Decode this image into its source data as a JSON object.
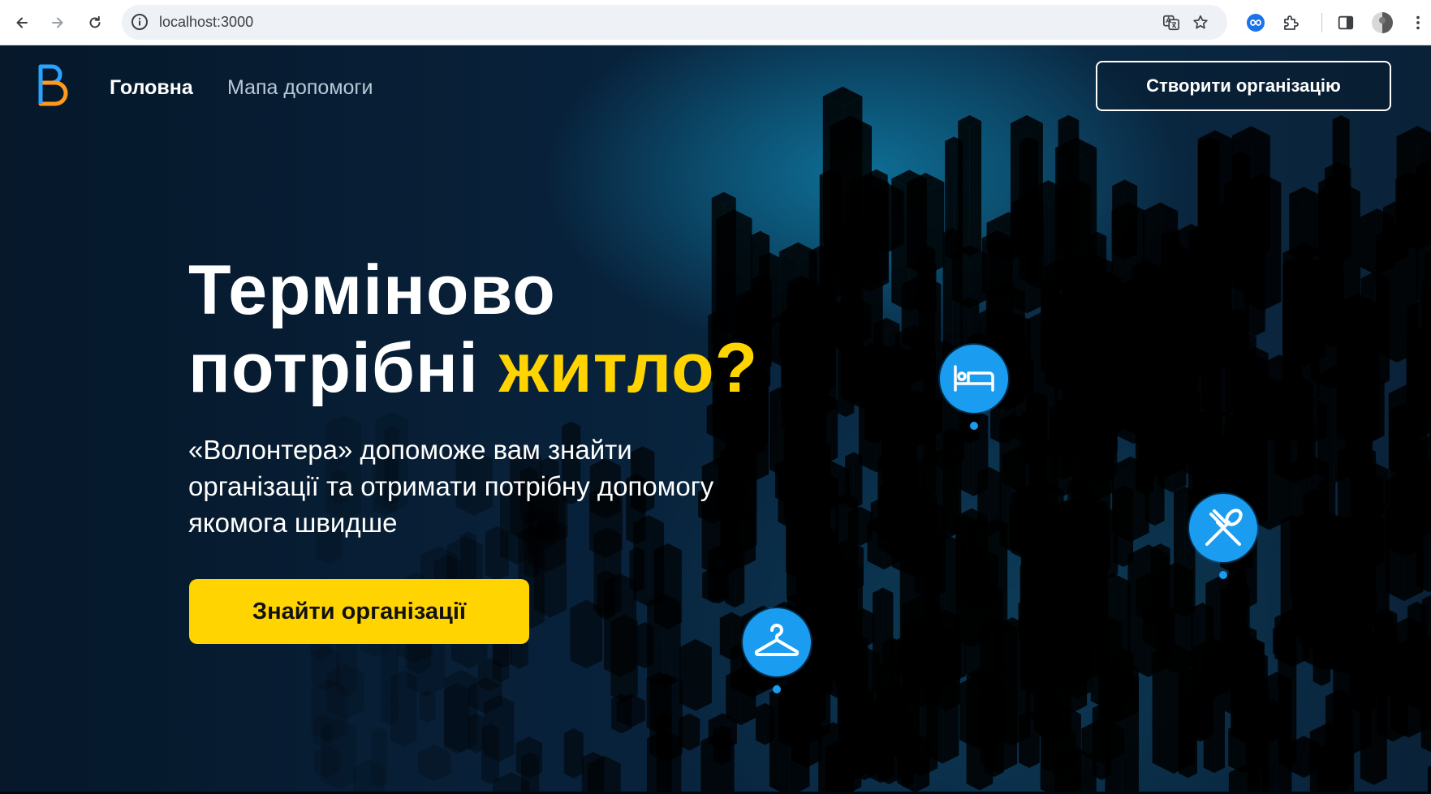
{
  "browser": {
    "url": "localhost:3000",
    "icons": [
      "back-icon",
      "forward-icon",
      "reload-icon",
      "site-info-icon",
      "translate-icon",
      "bookmark-star-icon",
      "extension-loop-icon",
      "extensions-puzzle-icon",
      "side-panel-icon",
      "profile-avatar",
      "more-menu-icon"
    ]
  },
  "header": {
    "logo_letter": "B",
    "nav": [
      {
        "label": "Головна"
      },
      {
        "label": "Мапа допомоги"
      }
    ],
    "create_button": "Створити організацію"
  },
  "hero": {
    "title_line1": "Терміново",
    "title_line2_prefix": "потрібні",
    "title_accent": "житло?",
    "subtitle": "«Волонтера» допоможе вам знайти організації та отримати потрібну допомогу якомога швидше",
    "cta": "Знайти організації"
  },
  "pins": [
    {
      "icon": "bed-icon"
    },
    {
      "icon": "fork-spoon-icon"
    },
    {
      "icon": "hanger-icon"
    }
  ],
  "colors": {
    "accent_yellow": "#ffd400",
    "pin_blue": "#1a9cf0",
    "background_dark": "#071a2b",
    "logo_blue": "#2aa3ff",
    "logo_orange": "#ff9a1f"
  }
}
